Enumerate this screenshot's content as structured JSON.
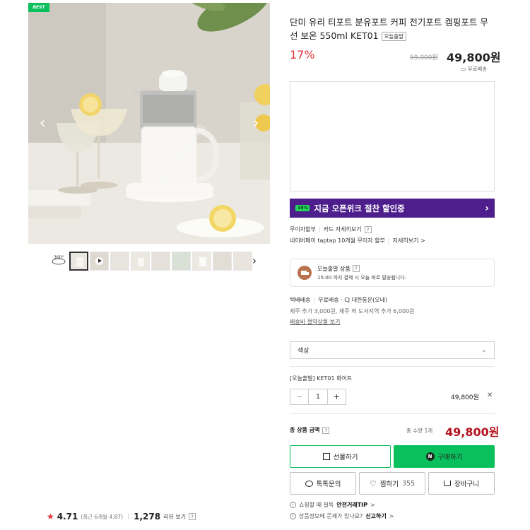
{
  "gallery": {
    "best_badge": "BEST",
    "view360_label": "360°",
    "thumb_count": 9,
    "rating": {
      "score": "4.71",
      "recent": "(최근 6개월 4.87)",
      "reviews_count": "1,278",
      "reviews_label": "리뷰 보기",
      "help": "?"
    }
  },
  "product": {
    "title": "단미 유리 티포트 분유포트 커피 전기포트 캠핑포트 무선 보온 550ml KET01",
    "tag": "오늘출발",
    "discount": "17%",
    "original_price": "59,000원",
    "sale_price": "49,800원",
    "free_shipping": "무료배송"
  },
  "promo": {
    "chip": "15%",
    "text": "지금 오픈위크 절찬 할인중",
    "arrow": "›"
  },
  "benefits": {
    "installment": "무이자할부",
    "card_detail": "카드 자세히보기",
    "help": "?",
    "naverpay": "네이버페이 taptap 10개월 무이자 할부",
    "naverpay_detail": "자세히보기 >"
  },
  "delivery": {
    "title": "오늘출발 상품",
    "help": "?",
    "desc": "15:00 까지 결제 시 오늘 바로 발송됩니다."
  },
  "shipping": {
    "type": "택배배송",
    "detail": "무료배송 · CJ 대한통운(오네)",
    "extra": "제주 추가 3,000원, 제주 외 도서지역 추가 6,000원",
    "bundle_link": "배송비 절약상품 보기"
  },
  "option": {
    "placeholder": "색상",
    "selected_name": "[오늘출발] KET01 화이트",
    "quantity": "1",
    "minus": "−",
    "plus": "+",
    "item_price": "49,800원",
    "remove": "✕"
  },
  "total": {
    "label": "총 상품 금액",
    "help": "?",
    "count": "총 수량 1개",
    "price": "49,800원"
  },
  "buttons": {
    "gift": "선물하기",
    "buy": "구매하기",
    "n_logo": "N",
    "inquiry": "톡톡문의",
    "wish": "찜하기",
    "wish_count": "355",
    "cart": "장바구니"
  },
  "footer": {
    "safe_text": "쇼핑할 때 필독",
    "safe_link": "안전거래TIP",
    "safe_arrow": ">",
    "report_text": "상품정보에 문제가 있나요?",
    "report_link": "신고하기",
    "report_arrow": ">"
  },
  "colors": {
    "accent_green": "#0ac05c",
    "promo_purple": "#4d1e8c",
    "discount_red": "#e0343d",
    "total_red": "#b3121d"
  }
}
